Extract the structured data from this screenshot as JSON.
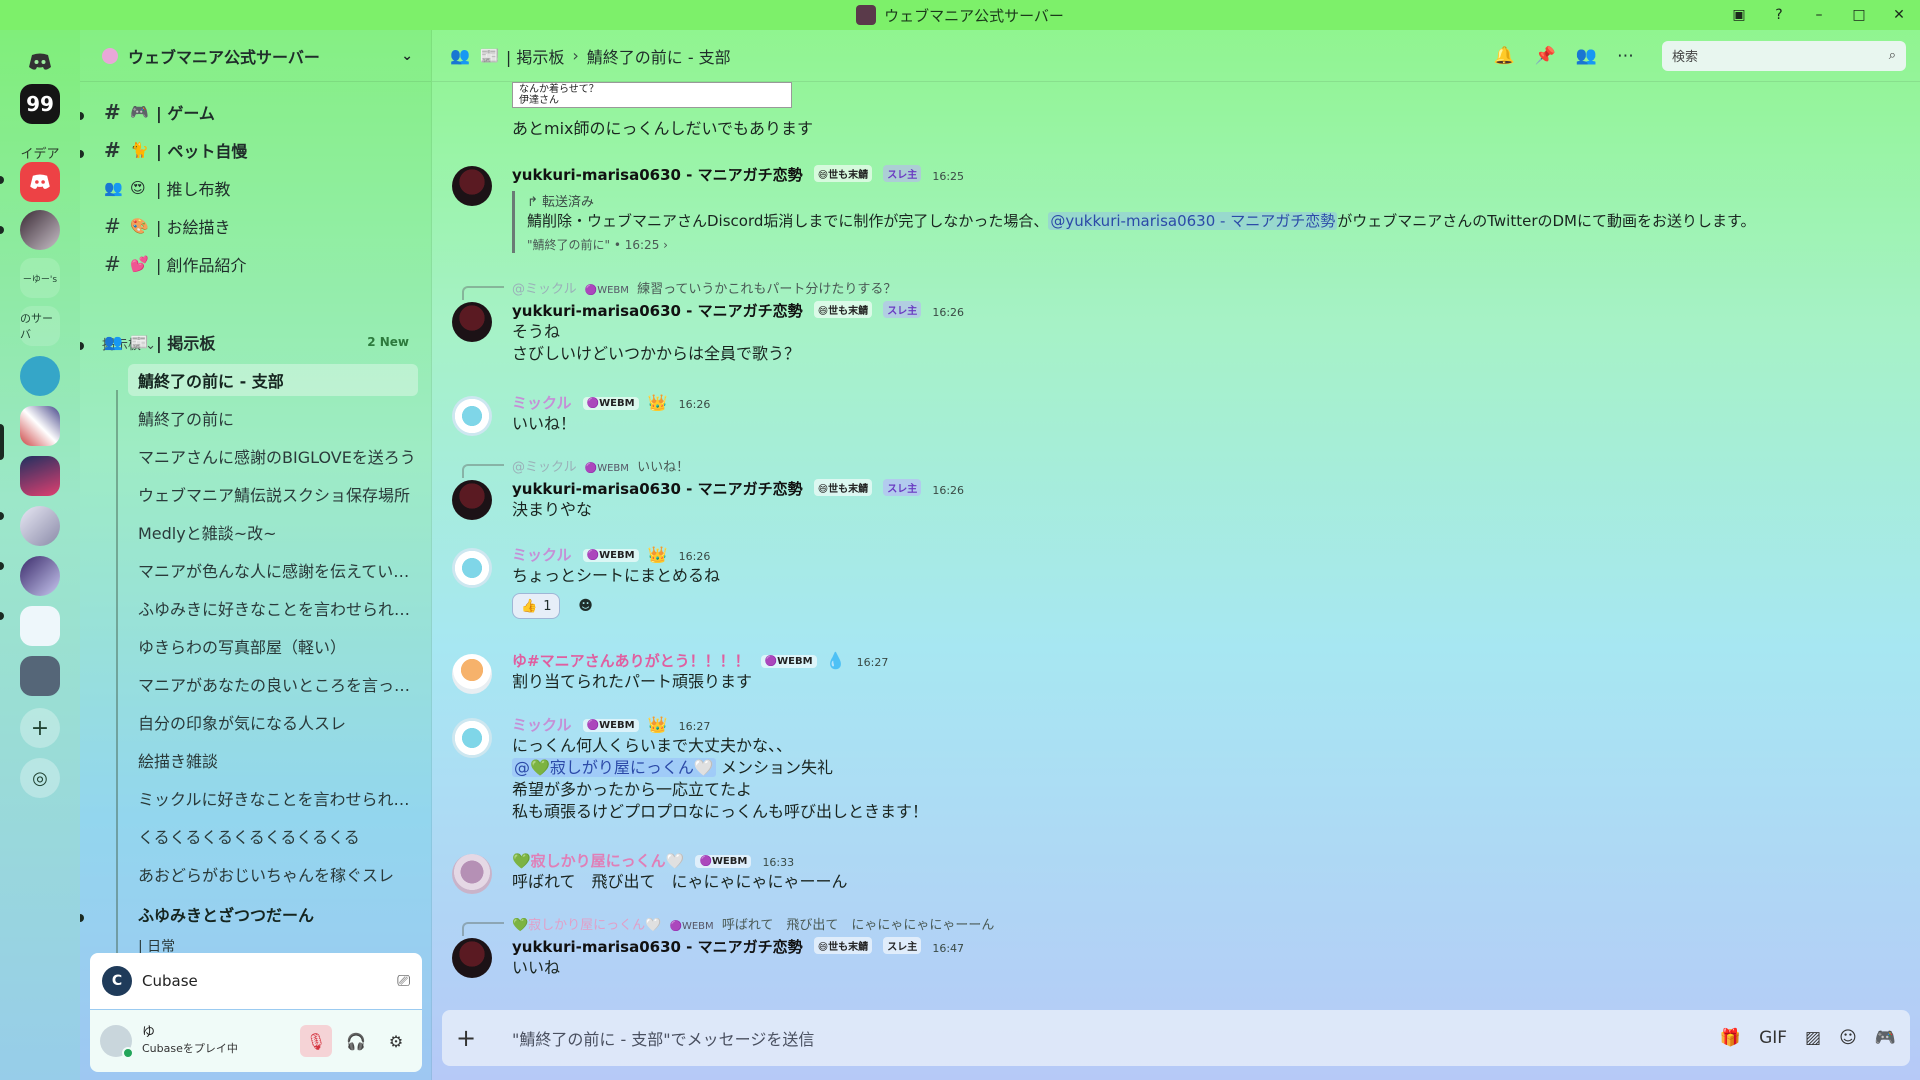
{
  "window": {
    "title": "ウェブマニア公式サーバー"
  },
  "servers": [
    {
      "label": "",
      "icon": "discord-home-icon",
      "color": "#5865f2"
    },
    {
      "label": "99",
      "icon": "quote-server-icon",
      "color": "#1b1b1b"
    },
    {
      "label": "イデア",
      "icon": "idea-server-icon",
      "color": "#a6f0b6"
    },
    {
      "label": "",
      "icon": "discord-red-server-icon",
      "color": "#ed4245"
    },
    {
      "label": "",
      "icon": "character-server-icon",
      "color": "#6b5060"
    },
    {
      "label": "ーゆー's",
      "icon": "yu-server-icon",
      "color": "#a6f0c6"
    },
    {
      "label": "のサーバ",
      "icon": "server-text-icon",
      "color": "#a3e6d2"
    },
    {
      "label": "",
      "icon": "mascot-server-icon",
      "color": "#3aa6c8"
    },
    {
      "label": "",
      "icon": "collage-server-icon",
      "color": "#c54a5a"
    },
    {
      "label": "",
      "icon": "webmania-server-icon",
      "color": "#d6406a"
    },
    {
      "label": "",
      "icon": "anime-server-icon",
      "color": "#b8b8d0"
    },
    {
      "label": "",
      "icon": "portrait-server-icon",
      "color": "#6a5aa8"
    },
    {
      "label": "",
      "icon": "building-server-icon",
      "color": "#eaf4f8"
    },
    {
      "label": "",
      "icon": "sunglasses-server-icon",
      "color": "#4a5a6a"
    },
    {
      "label": "+",
      "icon": "add-server-icon",
      "color": "#b4ecc8"
    },
    {
      "label": "◎",
      "icon": "discover-icon",
      "color": "#b4e6d6"
    }
  ],
  "sidebar": {
    "server_name": "ウェブマニア公式サーバー",
    "channels": [
      {
        "icon": "#",
        "emoji": "🎮",
        "name": "| ゲーム",
        "bold": true
      },
      {
        "icon": "#",
        "emoji": "🐈",
        "name": "| ペット自慢",
        "bold": true
      },
      {
        "icon": "👥",
        "emoji": "😍",
        "name": "| 推し布教",
        "bold": false
      },
      {
        "icon": "#",
        "emoji": "🎨",
        "name": "| お絵描き",
        "bold": false
      },
      {
        "icon": "#",
        "emoji": "💕",
        "name": "| 創作品紹介",
        "bold": false
      }
    ],
    "category": "掲示板 ⌄",
    "forum": {
      "name": "| 掲示板",
      "new_badge": "2 New"
    },
    "threads": [
      "鯖終了の前に - 支部",
      "鯖終了の前に",
      "マニアさんに感謝のBIGLOVEを送ろう",
      "ウェブマニア鯖伝説スクショ保存場所",
      "Medlyと雑談~改~",
      "マニアが色んな人に感謝を伝えてい…",
      "ふゆみきに好きなことを言わせられ…",
      "ゆきらわの写真部屋（軽い）",
      "マニアがあなたの良いところを言っ…",
      "自分の印象が気になる人スレ",
      "絵描き雑談",
      "ミックルに好きなことを言わせられ…",
      "くるくるくるくるくるくるくる",
      "あおどらがおじいちゃんを稼ぐスレ"
    ],
    "bold_thread": "ふゆみきとざつつだーん",
    "partial_item": "| 日常"
  },
  "activity": {
    "app": "Cubase"
  },
  "user": {
    "name": "ゆ",
    "status": "Cubaseをプレイ中"
  },
  "header": {
    "forum": "| 掲示板",
    "separator": "›",
    "thread": "鯖終了の前に - 支部",
    "search_placeholder": "検索"
  },
  "messages": {
    "snippet": "なんか着らせて？\n伊達さん",
    "m0": {
      "text": "あとmix師のにっくんしだいでもあります"
    },
    "m1": {
      "author": "yukkuri-marisa0630 - マニアガチ恋勢",
      "badge": "😄世も末鯖",
      "tag": "スレ主",
      "time": "16:25",
      "forwarded_label": "↱ 転送済み",
      "forwarded_before": "鯖削除・ウェブマニアさんDiscord垢消しまでに制作が完了しなかった場合、",
      "mention": "@yukkuri-marisa0630 - マニアガチ恋勢",
      "forwarded_after": "がウェブマニアさんのTwitterのDMにて動画をお送りします。",
      "source": "\"鯖終了の前に\" • 16:25 ›"
    },
    "m2": {
      "reply_name": "@ミックル",
      "reply_tag": "🟣WEBM",
      "reply_text": "練習っていうかこれもパート分けたりする？",
      "author": "yukkuri-marisa0630 - マニアガチ恋勢",
      "badge": "😄世も末鯖",
      "tag": "スレ主",
      "time": "16:26",
      "line1": "そうね",
      "line2": "さびしいけどいつかからは全員で歌う？"
    },
    "m3": {
      "author": "ミックル",
      "tag": "🟣WEBM",
      "crown": "👑",
      "time": "16:26",
      "text": "いいね！"
    },
    "m4": {
      "reply_name": "@ミックル",
      "reply_tag": "🟣WEBM",
      "reply_text": "いいね！",
      "author": "yukkuri-marisa0630 - マニアガチ恋勢",
      "badge": "😄世も末鯖",
      "tag": "スレ主",
      "time": "16:26",
      "text": "決まりやな"
    },
    "m5": {
      "author": "ミックル",
      "tag": "🟣WEBM",
      "crown": "👑",
      "time": "16:26",
      "text": "ちょっとシートにまとめるね",
      "reaction_emoji": "👍",
      "reaction_count": "1"
    },
    "m6": {
      "author": "ゆ#マニアさんありがとう！！！！",
      "tag": "🟣WEBM",
      "extra": "💧",
      "time": "16:27",
      "text": "割り当てられたパート頑張ります"
    },
    "m7": {
      "author": "ミックル",
      "tag": "🟣WEBM",
      "crown": "👑",
      "time": "16:27",
      "line1": "にっくん何人くらいまで大丈夫かな、、",
      "mention": "@💚寂しがり屋にっくん🤍",
      "line2_after": " メンション失礼",
      "line3": "希望が多かったから一応立てたよ",
      "line4": "私も頑張るけどプロプロなにっくんも呼び出しときます！"
    },
    "m8": {
      "author": "💚寂しかり屋にっくん🤍",
      "tag": "🟣WEBM",
      "time": "16:33",
      "text": "呼ばれて　飛び出て　にゃにゃにゃにゃーーん"
    },
    "m9": {
      "reply_name": "💚寂しかり屋にっくん🤍",
      "reply_tag": "🟣WEBM",
      "reply_text": "呼ばれて　飛び出て　にゃにゃにゃにゃーーん",
      "author": "yukkuri-marisa0630 - マニアガチ恋勢",
      "badge": "😄世も末鯖",
      "tag": "スレ主",
      "time": "16:47",
      "text": "いいね"
    }
  },
  "composer": {
    "placeholder": "\"鯖終了の前に - 支部\"でメッセージを送信"
  }
}
